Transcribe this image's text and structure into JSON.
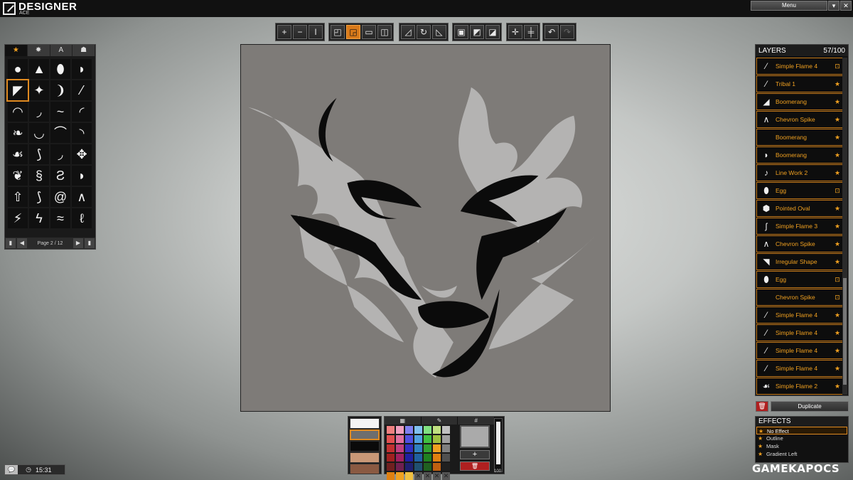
{
  "app": {
    "title": "DESIGNER",
    "subtitle": "ACE",
    "menu_label": "Menu",
    "menu_arrow": "▾",
    "close": "✕"
  },
  "toolbar": {
    "groups": [
      {
        "name": "transform",
        "buttons": [
          "+",
          "−",
          "I"
        ]
      },
      {
        "name": "alignment",
        "buttons": [
          "◰",
          "◲",
          "▭",
          "◫"
        ]
      },
      {
        "name": "rotate",
        "buttons": [
          "◿",
          "↻",
          "◺"
        ]
      },
      {
        "name": "arrange",
        "buttons": [
          "▣",
          "◩",
          "◪"
        ]
      },
      {
        "name": "snap",
        "buttons": [
          "✛",
          "╪"
        ]
      },
      {
        "name": "history",
        "buttons": [
          "↶",
          "↷"
        ]
      }
    ]
  },
  "shape_library": {
    "tabs": [
      "★",
      "✸",
      "A",
      "☗"
    ],
    "shapes": [
      "●",
      "▲",
      "⬮",
      "◗",
      "◤",
      "✦",
      "❩",
      "⁄",
      "◠",
      "◞",
      "~",
      "◜",
      "❧",
      "◡",
      "⌒",
      "◝",
      "☙",
      "⟆",
      "◞",
      "✥",
      "❦",
      "§",
      "Ƨ",
      "◗",
      "⇧",
      "⟆",
      "@",
      "∧",
      "⚡",
      "ϟ",
      "≈",
      "ℓ"
    ],
    "selected_index": 4,
    "page_label": "Page 2 / 12"
  },
  "layers": {
    "title": "LAYERS",
    "count": "57/100",
    "items": [
      {
        "name": "Simple Flame 4",
        "thumb": "⁄",
        "badge": "⊡"
      },
      {
        "name": "Tribal 1",
        "thumb": "⁄",
        "badge": "★"
      },
      {
        "name": "Boomerang",
        "thumb": "◢",
        "badge": "★"
      },
      {
        "name": "Chevron Spike",
        "thumb": "∧",
        "badge": "★"
      },
      {
        "name": "Boomerang",
        "thumb": "",
        "badge": "★"
      },
      {
        "name": "Boomerang",
        "thumb": "◗",
        "badge": "★"
      },
      {
        "name": "Line Work 2",
        "thumb": "♪",
        "badge": "★"
      },
      {
        "name": "Egg",
        "thumb": "⬮",
        "badge": "⊡"
      },
      {
        "name": "Pointed Oval",
        "thumb": "⬢",
        "badge": "★"
      },
      {
        "name": "Simple Flame 3",
        "thumb": "ʃ",
        "badge": "★"
      },
      {
        "name": "Chevron Spike",
        "thumb": "∧",
        "badge": "★"
      },
      {
        "name": "Irregular Shape",
        "thumb": "◥",
        "badge": "★"
      },
      {
        "name": "Egg",
        "thumb": "⬮",
        "badge": "⊡"
      },
      {
        "name": "Chevron Spike",
        "thumb": "",
        "badge": "⊡"
      },
      {
        "name": "Simple Flame 4",
        "thumb": "⁄",
        "badge": "★"
      },
      {
        "name": "Simple Flame 4",
        "thumb": "⁄",
        "badge": "★"
      },
      {
        "name": "Simple Flame 4",
        "thumb": "⁄",
        "badge": "★"
      },
      {
        "name": "Simple Flame 4",
        "thumb": "⁄",
        "badge": "★"
      },
      {
        "name": "Simple Flame 2",
        "thumb": "☙",
        "badge": "★"
      }
    ],
    "delete_icon": "🗑",
    "duplicate_label": "Duplicate"
  },
  "effects": {
    "title": "EFFECTS",
    "items": [
      {
        "name": "No Effect",
        "active": true
      },
      {
        "name": "Outline",
        "active": false
      },
      {
        "name": "Mask",
        "active": false
      },
      {
        "name": "Gradient Left",
        "active": false
      }
    ]
  },
  "colors": {
    "swatches": [
      "#f4f4f4",
      "#6e6e6e",
      "#0a0a0a",
      "#c99877",
      "#8a5a42"
    ],
    "selected_swatch": 1,
    "palette_tabs": [
      "▦",
      "✎",
      "#"
    ],
    "palette": [
      "#f08080",
      "#f0a0c0",
      "#8080f0",
      "#80c0f0",
      "#80e080",
      "#c0e080",
      "#c0c0c0",
      "#e05050",
      "#e070a0",
      "#5050e0",
      "#50a0e0",
      "#40c040",
      "#a0c040",
      "#a0a0a0",
      "#c03030",
      "#c04080",
      "#3030c0",
      "#3080c0",
      "#30a030",
      "#f0a020",
      "#808080",
      "#a02020",
      "#a02060",
      "#2020a0",
      "#2060a0",
      "#208020",
      "#e08010",
      "#505050",
      "#702020",
      "#702050",
      "#202070",
      "#205070",
      "#206020",
      "#c06010",
      "#202020",
      "#e08010",
      "#f0a020",
      "#f0c040",
      "x",
      "x",
      "x",
      "x"
    ],
    "preview_color": "#aaaaaa",
    "add_label": "+",
    "remove_label": "🗑",
    "opacity_label": "100",
    "opacity": 100
  },
  "status": {
    "chat_icon": "💬",
    "clock_icon": "◷",
    "time": "15:31"
  },
  "watermark": "GAMEKAPOCS"
}
